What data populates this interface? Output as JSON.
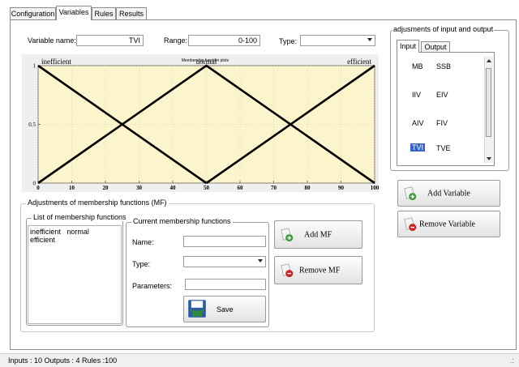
{
  "tabs": [
    "Configuration",
    "Variables",
    "Rules",
    "Results"
  ],
  "active_tab": "Variables",
  "variable": {
    "name_label": "Variable name:",
    "name_value": "TVI",
    "range_label": "Range:",
    "range_value": "0-100",
    "type_label": "Type:",
    "type_value": ""
  },
  "chart_data": {
    "type": "line",
    "title": "Membership function plots",
    "xlim": [
      0,
      100
    ],
    "ylim": [
      0,
      1
    ],
    "x_ticks": [
      "0",
      "10",
      "20",
      "30",
      "40",
      "50",
      "60",
      "70",
      "80",
      "90",
      "100"
    ],
    "y_ticks": [
      "0",
      "0.5",
      "1"
    ],
    "series": [
      {
        "name": "inefficient",
        "x": [
          0,
          50
        ],
        "y": [
          1,
          0
        ]
      },
      {
        "name": "normal",
        "x": [
          0,
          50,
          100
        ],
        "y": [
          0,
          1,
          0
        ]
      },
      {
        "name": "efficient",
        "x": [
          50,
          100
        ],
        "y": [
          0,
          1
        ]
      }
    ],
    "background": "#fbf4cc",
    "line_color": "#000000"
  },
  "mf_adjust": {
    "title": "Adjustments of membership functions (MF)",
    "list_title": "List of membership functions",
    "list_items": [
      "inefficient",
      "normal",
      "efficient"
    ],
    "current_title": "Current membership functions",
    "name_label": "Name:",
    "type_label": "Type:",
    "params_label": "Parameters:",
    "name_value": "",
    "type_value": "",
    "params_value": "",
    "save_label": "Save",
    "add_label": "Add MF",
    "remove_label": "Remove MF"
  },
  "io": {
    "title": "adjusments of input and output",
    "tabs": [
      "Input",
      "Output"
    ],
    "active_tab": "Input",
    "variables": [
      [
        "MB",
        "SSB"
      ],
      [
        "IIV",
        "EIV"
      ],
      [
        "AIV",
        "FIV"
      ],
      [
        "TVI",
        "TVE"
      ]
    ],
    "selected": "TVI",
    "add_label": "Add Variable",
    "remove_label": "Remove Variable"
  },
  "status": {
    "text": "Inputs : 10  Outputs : 4  Rules :100",
    "grip": ".:"
  },
  "colors": {
    "selection": "#3366cc",
    "add_green": "#3a9b3a",
    "remove_red": "#cc2222",
    "save_green": "#2f8a3a",
    "save_blue": "#2b5aa8"
  }
}
